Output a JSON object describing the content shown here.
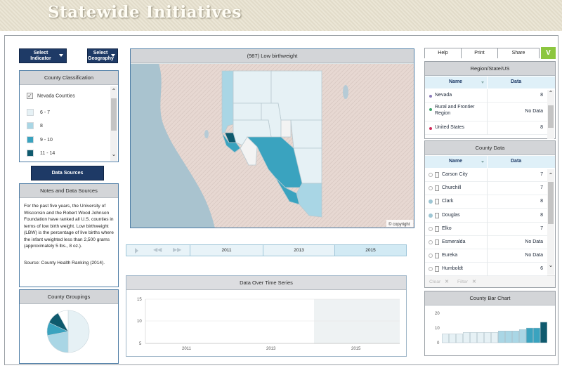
{
  "header": {
    "title": "Statewide Initiatives"
  },
  "toolbar": {
    "select_indicator": "Select\nIndicator",
    "select_indicator_l1": "Select",
    "select_indicator_l2": "Indicator",
    "select_geography_l1": "Select",
    "select_geography_l2": "Geography"
  },
  "classification": {
    "title": "County Classification",
    "checkbox_label": "Nevada Counties",
    "checked": true,
    "legend": [
      {
        "label": "6 - 7",
        "color": "#e6f1f5"
      },
      {
        "label": "8",
        "color": "#a9d6e5"
      },
      {
        "label": "9 - 10",
        "color": "#3aa3bf"
      },
      {
        "label": "11 - 14",
        "color": "#0f5a6e"
      }
    ]
  },
  "data_sources_button": "Data Sources",
  "notes": {
    "title": "Notes and Data Sources",
    "body": "For the past five years, the University of Wisconsin and the Robert Wood Johnson Foundation have ranked all U.S. counties in terms of low birth weight. Low birthweight (LBW) is the percentage of live births where the infant weighted less than 2,500 grams (approximately 5 lbs., 8 oz.).",
    "source": "Source: County Health Ranking (2014)."
  },
  "groupings": {
    "title": "County Groupings",
    "slices": [
      {
        "value": 0.5,
        "color": "#e6f1f5"
      },
      {
        "value": 0.22,
        "color": "#a9d6e5"
      },
      {
        "value": 0.1,
        "color": "#3aa3bf"
      },
      {
        "value": 0.1,
        "color": "#0f5a6e"
      },
      {
        "value": 0.08,
        "color": "#ffffff"
      }
    ]
  },
  "map": {
    "title": "(987) Low birthweight",
    "copyright": "© copyright"
  },
  "timeline": {
    "years": [
      "2011",
      "2013",
      "2015"
    ],
    "selected": "2015"
  },
  "time_series": {
    "title": "Data Over Time Series",
    "y_ticks": [
      "15",
      "10",
      "5"
    ],
    "x_ticks": [
      "2011",
      "2013",
      "2015"
    ]
  },
  "top_links": {
    "help": "Help",
    "print": "Print",
    "share": "Share"
  },
  "region": {
    "title": "Region/State/US",
    "col_name": "Name",
    "col_data": "Data",
    "rows": [
      {
        "name": "Nevada",
        "data": "8",
        "dot": "#8a7ab8"
      },
      {
        "name": "Rural and Frontier Region",
        "data": "No Data",
        "dot": "#3aa36b"
      },
      {
        "name": "United States",
        "data": "8",
        "dot": "#d02a5a"
      }
    ]
  },
  "county": {
    "title": "County Data",
    "col_name": "Name",
    "col_data": "Data",
    "rows": [
      {
        "name": "Carson City",
        "data": "7",
        "selected": false
      },
      {
        "name": "Churchill",
        "data": "7",
        "selected": false
      },
      {
        "name": "Clark",
        "data": "8",
        "selected": true
      },
      {
        "name": "Douglas",
        "data": "8",
        "selected": true
      },
      {
        "name": "Elko",
        "data": "7",
        "selected": false
      },
      {
        "name": "Esmeralda",
        "data": "No Data",
        "selected": false
      },
      {
        "name": "Eureka",
        "data": "No Data",
        "selected": false
      },
      {
        "name": "Humboldt",
        "data": "6",
        "selected": false
      }
    ],
    "clear": "Clear",
    "filter": "Filter"
  },
  "bar_chart": {
    "title": "County Bar Chart",
    "chart_data": {
      "type": "bar",
      "title": "County Bar Chart",
      "y_ticks": [
        20,
        10,
        0
      ],
      "ylim": [
        0,
        22
      ],
      "values": [
        6,
        6,
        6,
        7,
        7,
        7,
        7,
        7,
        8,
        8,
        8,
        9,
        10,
        10,
        14
      ],
      "colors": [
        "#e6f1f5",
        "#e6f1f5",
        "#e6f1f5",
        "#e6f1f5",
        "#e6f1f5",
        "#e6f1f5",
        "#e6f1f5",
        "#e6f1f5",
        "#a9d6e5",
        "#a9d6e5",
        "#a9d6e5",
        "#a9d6e5",
        "#3aa3bf",
        "#3aa3bf",
        "#0f5a6e"
      ]
    }
  }
}
